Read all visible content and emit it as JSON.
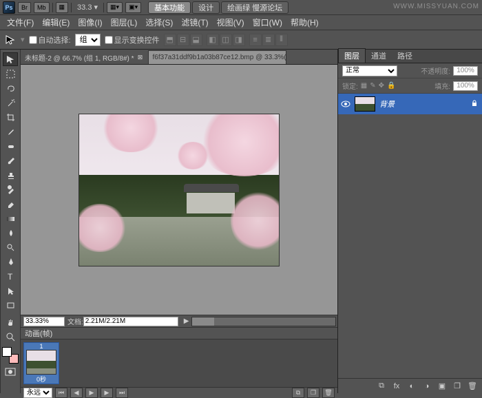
{
  "top": {
    "ps": "Ps",
    "br": "Br",
    "mb": "Mb",
    "zoom": "33.3",
    "workspaces": [
      "基本功能",
      "设计",
      "绘画绿 慢源论坛"
    ],
    "ws_active": 0,
    "watermark": "WWW.MISSYUAN.COM"
  },
  "menu": [
    "文件(F)",
    "编辑(E)",
    "图像(I)",
    "图层(L)",
    "选择(S)",
    "滤镜(T)",
    "视图(V)",
    "窗口(W)",
    "帮助(H)"
  ],
  "options": {
    "auto_select": "自动选择:",
    "group": "组",
    "show_transform": "显示变换控件"
  },
  "doc_tabs": [
    {
      "title": "未标题-2 @ 66.7% (组 1, RGB/8#) *",
      "active": false
    },
    {
      "title": "f6f37a31ddf9b1a03b87ce12.bmp @ 33.3%(RGB/",
      "active": true
    }
  ],
  "status": {
    "zoom": "33.33%",
    "doc_label": "文档:",
    "doc_size": "2.21M/2.21M"
  },
  "animation": {
    "title": "动画(帧)",
    "frames": [
      {
        "n": "1",
        "delay": "0秒"
      }
    ],
    "loop": "永远"
  },
  "panels": {
    "tabs1": [
      "图层",
      "通道",
      "路径"
    ],
    "blend": "正常",
    "opacity_label": "不透明度:",
    "opacity": "100%",
    "lock_label": "锁定:",
    "fill_label": "填充:",
    "fill": "100%",
    "layers": [
      {
        "name": "背景",
        "locked": true
      }
    ]
  }
}
